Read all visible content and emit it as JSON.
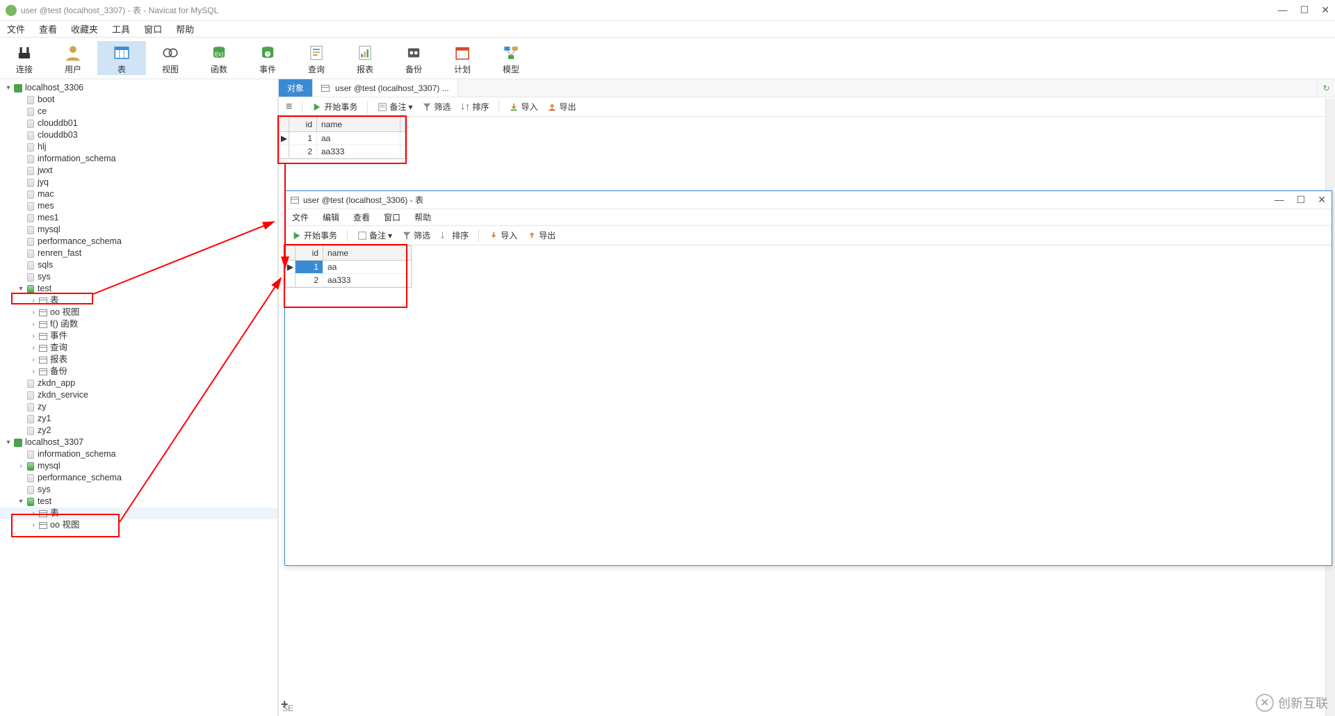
{
  "window": {
    "title": "user @test (localhost_3307) - 表 - Navicat for MySQL"
  },
  "menu": [
    "文件",
    "查看",
    "收藏夹",
    "工具",
    "窗口",
    "帮助"
  ],
  "ribbon": [
    {
      "label": "连接",
      "icon": "plug"
    },
    {
      "label": "用户",
      "icon": "user"
    },
    {
      "label": "表",
      "icon": "table",
      "active": true
    },
    {
      "label": "视图",
      "icon": "view"
    },
    {
      "label": "函数",
      "icon": "fx"
    },
    {
      "label": "事件",
      "icon": "event"
    },
    {
      "label": "查询",
      "icon": "query"
    },
    {
      "label": "报表",
      "icon": "report"
    },
    {
      "label": "备份",
      "icon": "backup"
    },
    {
      "label": "计划",
      "icon": "plan"
    },
    {
      "label": "模型",
      "icon": "model"
    }
  ],
  "tree": {
    "conn1": {
      "name": "localhost_3306"
    },
    "conn1_dbs": [
      "boot",
      "ce",
      "clouddb01",
      "clouddb03",
      "hlj",
      "information_schema",
      "jwxt",
      "jyq",
      "mac",
      "mes",
      "mes1",
      "mysql",
      "performance_schema",
      "renren_fast",
      "sqls",
      "sys"
    ],
    "test1": {
      "name": "test"
    },
    "test1_children": [
      "表",
      "视图",
      "函数",
      "事件",
      "查询",
      "报表",
      "备份"
    ],
    "test1_prefix": [
      "",
      "oo",
      "f()",
      "",
      "",
      "",
      ""
    ],
    "conn1_dbs_after": [
      "zkdn_app",
      "zkdn_service",
      "zy",
      "zy1",
      "zy2"
    ],
    "conn2": {
      "name": "localhost_3307"
    },
    "conn2_dbs": [
      "information_schema",
      "mysql",
      "performance_schema",
      "sys"
    ],
    "test2": {
      "name": "test"
    },
    "test2_children": [
      "表",
      "视图"
    ],
    "test2_prefix": [
      "",
      "oo"
    ]
  },
  "tabs": {
    "object_tab": "对象",
    "data_tab": "user @test (localhost_3307) ..."
  },
  "toolbar_top": {
    "start_tx": "开始事务",
    "memo": "备注",
    "filter": "筛选",
    "sort": "排序",
    "import": "导入",
    "export": "导出"
  },
  "grid1": {
    "cols": [
      "id",
      "name"
    ],
    "rows": [
      {
        "id": "1",
        "name": "aa"
      },
      {
        "id": "2",
        "name": "aa333"
      }
    ]
  },
  "inner_window": {
    "title": "user @test (localhost_3306) - 表",
    "menu": [
      "文件",
      "编辑",
      "查看",
      "窗口",
      "帮助"
    ]
  },
  "grid2": {
    "cols": [
      "id",
      "name"
    ],
    "rows": [
      {
        "id": "1",
        "name": "aa",
        "selected": true
      },
      {
        "id": "2",
        "name": "aa333"
      }
    ]
  },
  "watermark": "创新互联",
  "bottom_status": "SE"
}
